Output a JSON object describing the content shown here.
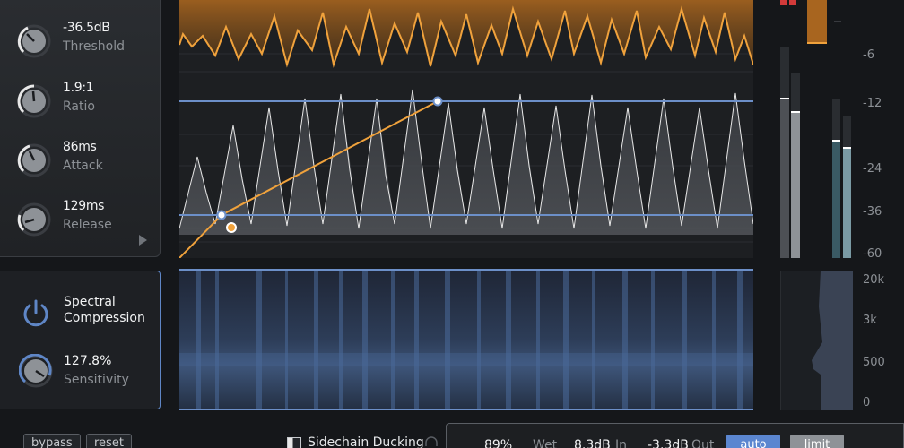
{
  "controls": {
    "threshold": {
      "value": "-36.5dB",
      "label": "Threshold"
    },
    "ratio": {
      "value": "1.9:1",
      "label": "Ratio"
    },
    "attack": {
      "value": "86ms",
      "label": "Attack"
    },
    "release": {
      "value": "129ms",
      "label": "Release"
    }
  },
  "spectral": {
    "title": "Spectral\nCompression",
    "sensitivity_value": "127.8%",
    "sensitivity_label": "Sensitivity"
  },
  "db_scale": [
    "-6",
    "-12",
    "-24",
    "-36",
    "-60"
  ],
  "freq_scale": [
    "20k",
    "3k",
    "500",
    "0"
  ],
  "bottom": {
    "bypass": "bypass",
    "reset": "reset",
    "sidechain_label": "Sidechain Ducking",
    "wet_value": "89%",
    "wet_label": "Wet",
    "in_value": "8.3dB",
    "in_label": "In",
    "out_value": "-3.3dB",
    "out_label": "Out",
    "auto_label": "auto",
    "limit_label": "limit"
  },
  "colors": {
    "accent_blue": "#5f86c6",
    "gain_reduction_orange": "#f0a23c",
    "button_auto_bg": "#5b86d0"
  }
}
